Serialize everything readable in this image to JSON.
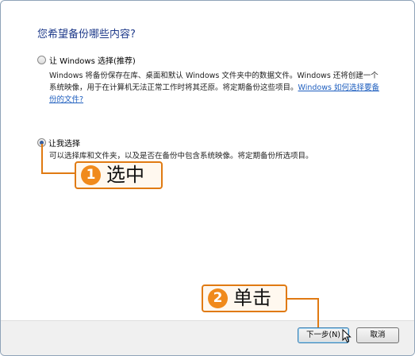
{
  "dialog": {
    "heading": "您希望备份哪些内容?",
    "option1": {
      "label": "让 Windows 选择(推荐)",
      "desc_line1": "Windows 将备份保存在库、桌面和默认 Windows 文件夹中的数据文件。Windows 还将创建一个",
      "desc_line2": "系统映像，用于在计算机无法正常工作时将其还原。将定期备份这些项目。",
      "desc_link_part1": "Windows 如何选择要备",
      "desc_link_part2": "份的文件?"
    },
    "option2": {
      "label": "让我选择",
      "desc": "可以选择库和文件夹，以及是否在备份中包含系统映像。将定期备份所选项目。"
    },
    "buttons": {
      "next": "下一步(N)",
      "cancel": "取消"
    }
  },
  "annotations": {
    "step1": {
      "number": "1",
      "text": "选中"
    },
    "step2": {
      "number": "2",
      "text": "单击"
    }
  },
  "colors": {
    "accent": "#e07a12",
    "heading": "#1e3a8a",
    "link": "#1f5fbf"
  }
}
